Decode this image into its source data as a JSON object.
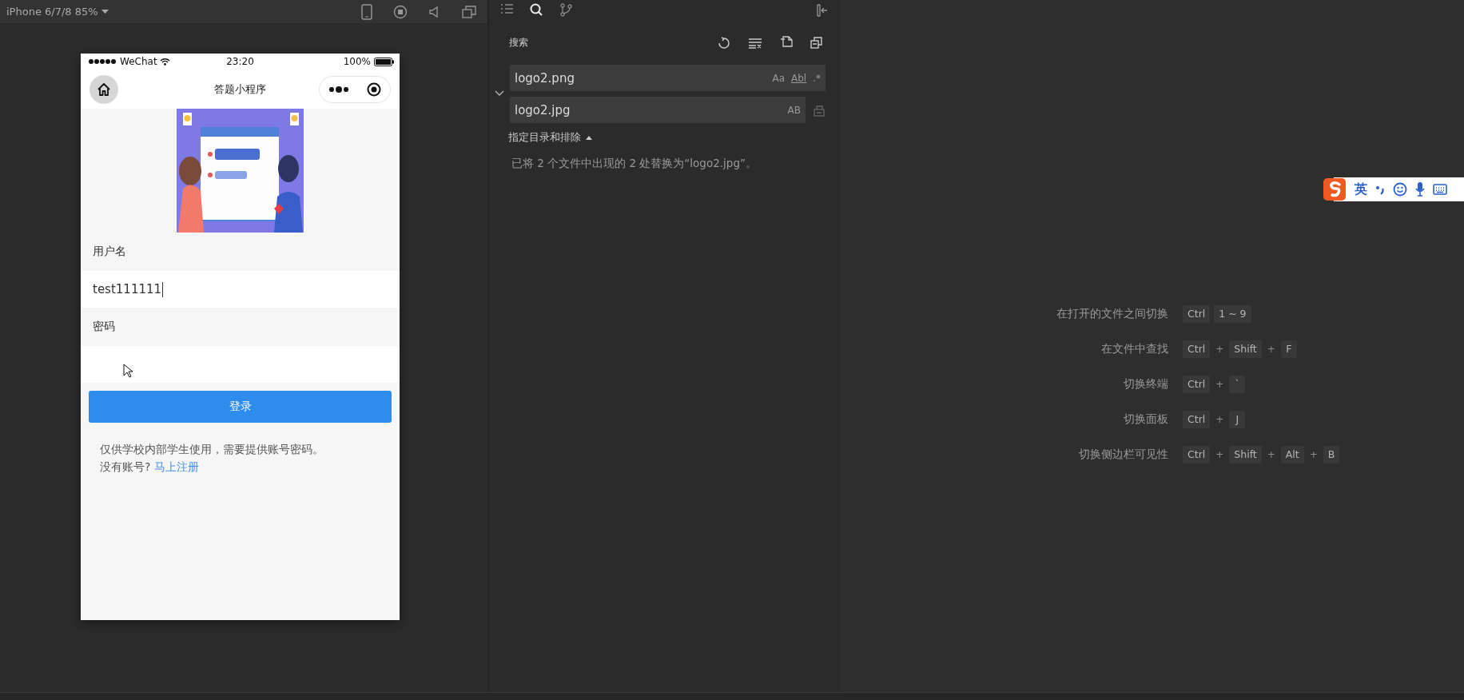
{
  "simulator": {
    "device": "iPhone 6/7/8 85%",
    "phone": {
      "status_bar": {
        "carrier": "WeChat",
        "time": "23:20",
        "battery": "100%"
      },
      "nav_title": "答题小程序",
      "fields": [
        {
          "label": "用户名",
          "value": "test111111",
          "focused": true
        },
        {
          "label": "密码",
          "focused": false
        }
      ],
      "login_button": "登录",
      "notice": "仅供学校内部学生使用，需要提供账号密码。",
      "no_account": "没有账号?",
      "register_link": "马上注册"
    }
  },
  "search_panel": {
    "activity_tabs": [
      {
        "kind": "explorer",
        "selected": false
      },
      {
        "kind": "search",
        "selected": true
      },
      {
        "kind": "branch",
        "selected": false
      }
    ],
    "title": "搜索",
    "search": {
      "value": "logo2.png",
      "options": [
        "Aa",
        "Abl",
        ".*"
      ]
    },
    "replace": {
      "value": "logo2.jpg",
      "option": "AB"
    },
    "scope_toggle": "指定目录和排除",
    "message": "已将 2 个文件中出现的 2 处替换为“logo2.jpg”。"
  },
  "shortcuts": [
    {
      "label": "在打开的文件之间切换",
      "keys": [
        {
          "kind": "key",
          "text": "Ctrl"
        },
        {
          "kind": "key",
          "text": "1 ~ 9"
        }
      ]
    },
    {
      "label": "在文件中查找",
      "keys": [
        {
          "kind": "key",
          "text": "Ctrl"
        },
        {
          "kind": "plus",
          "text": "+"
        },
        {
          "kind": "key",
          "text": "Shift"
        },
        {
          "kind": "plus",
          "text": "+"
        },
        {
          "kind": "key",
          "text": "F"
        }
      ]
    },
    {
      "label": "切换终端",
      "keys": [
        {
          "kind": "key",
          "text": "Ctrl"
        },
        {
          "kind": "plus",
          "text": "+"
        },
        {
          "kind": "key",
          "text": "`"
        }
      ]
    },
    {
      "label": "切换面板",
      "keys": [
        {
          "kind": "key",
          "text": "Ctrl"
        },
        {
          "kind": "plus",
          "text": "+"
        },
        {
          "kind": "key",
          "text": "J"
        }
      ]
    },
    {
      "label": "切换侧边栏可见性",
      "keys": [
        {
          "kind": "key",
          "text": "Ctrl"
        },
        {
          "kind": "plus",
          "text": "+"
        },
        {
          "kind": "key",
          "text": "Shift"
        },
        {
          "kind": "plus",
          "text": "+"
        },
        {
          "kind": "key",
          "text": "Alt"
        },
        {
          "kind": "plus",
          "text": "+"
        },
        {
          "kind": "key",
          "text": "B"
        }
      ]
    }
  ],
  "ime": {
    "language": "英"
  }
}
